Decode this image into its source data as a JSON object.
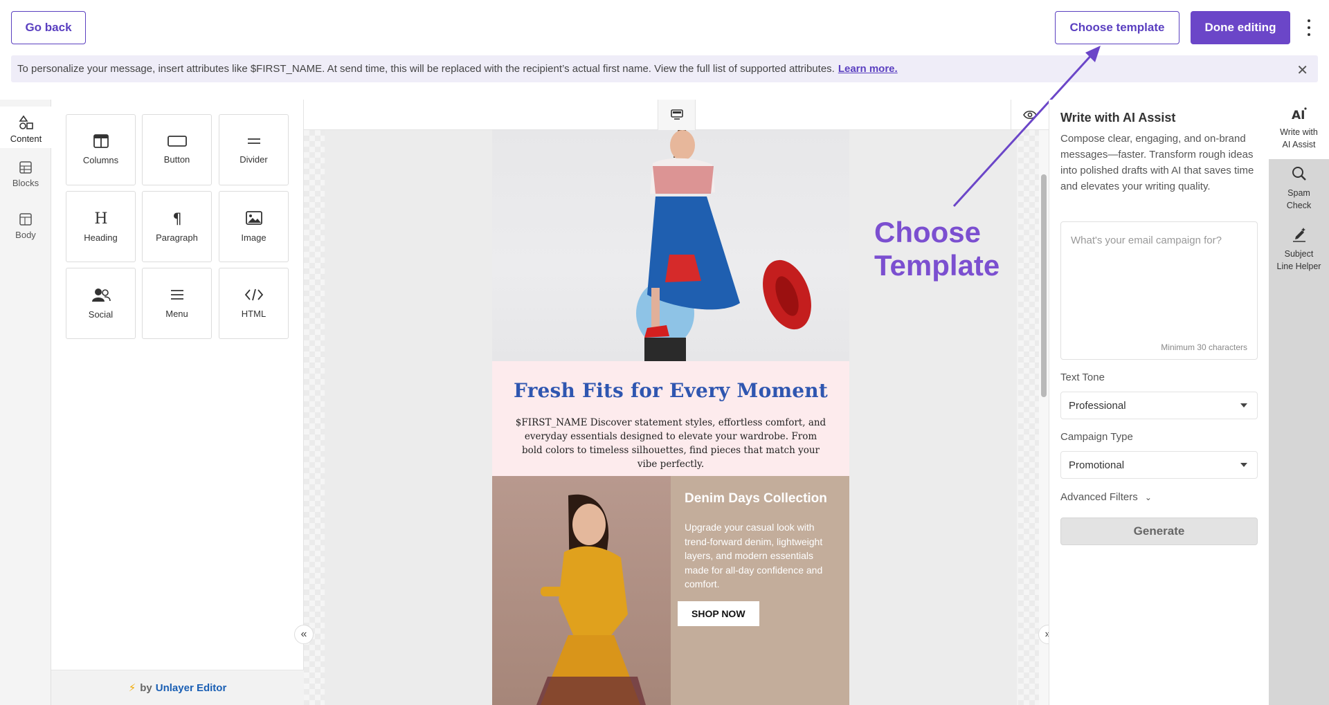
{
  "header": {
    "back_label": "Go back",
    "choose_template_label": "Choose template",
    "done_label": "Done editing"
  },
  "banner": {
    "text": "To personalize your message, insert attributes like $FIRST_NAME. At send time, this will be replaced with the recipient’s actual first name. View the full list of supported attributes.",
    "link": "Learn more."
  },
  "left_rail": [
    {
      "label": "Content",
      "icon": "shapes-icon"
    },
    {
      "label": "Blocks",
      "icon": "blocks-icon"
    },
    {
      "label": "Body",
      "icon": "layout-icon"
    }
  ],
  "content_tiles": [
    {
      "label": "Columns",
      "icon": "columns-icon"
    },
    {
      "label": "Button",
      "icon": "button-icon"
    },
    {
      "label": "Divider",
      "icon": "divider-icon"
    },
    {
      "label": "Heading",
      "icon": "heading-icon"
    },
    {
      "label": "Paragraph",
      "icon": "paragraph-icon"
    },
    {
      "label": "Image",
      "icon": "image-icon"
    },
    {
      "label": "Social",
      "icon": "social-icon"
    },
    {
      "label": "Menu",
      "icon": "menu-icon"
    },
    {
      "label": "HTML",
      "icon": "code-icon"
    }
  ],
  "powered_by": {
    "by": "by",
    "brand": "Unlayer Editor"
  },
  "email": {
    "headline": "Fresh Fits for Every Moment",
    "intro": "$FIRST_NAME Discover statement styles, effortless comfort, and everyday essentials designed to elevate your wardrobe. From bold colors to timeless silhouettes, find pieces that match your vibe perfectly.",
    "collection_title": "Denim Days Collection",
    "collection_text": "Upgrade your casual look with trend-forward denim, lightweight layers, and modern essentials made for all-day confidence and comfort.",
    "cta": "SHOP NOW"
  },
  "annotation": {
    "line1": "Choose",
    "line2": "Template"
  },
  "ai_panel": {
    "title": "Write with AI Assist",
    "description": "Compose clear, engaging, and on-brand messages—faster. Transform rough ideas into polished drafts with AI that saves time and elevates your writing quality.",
    "placeholder": "What's your email campaign for?",
    "min_hint": "Minimum 30 characters",
    "tone_label": "Text Tone",
    "tone_value": "Professional",
    "campaign_label": "Campaign Type",
    "campaign_value": "Promotional",
    "advanced_label": "Advanced Filters",
    "generate_label": "Generate"
  },
  "far_rail": [
    {
      "line1": "Write with",
      "line2": "AI Assist",
      "icon": "ai-icon"
    },
    {
      "line1": "Spam",
      "line2": "Check",
      "icon": "magnify-icon"
    },
    {
      "line1": "Subject",
      "line2": "Line Helper",
      "icon": "sparkle-pen-icon"
    }
  ],
  "colors": {
    "accent": "#6b46c8",
    "headline_blue": "#2f56b0",
    "annotation": "#7b4fd0"
  }
}
